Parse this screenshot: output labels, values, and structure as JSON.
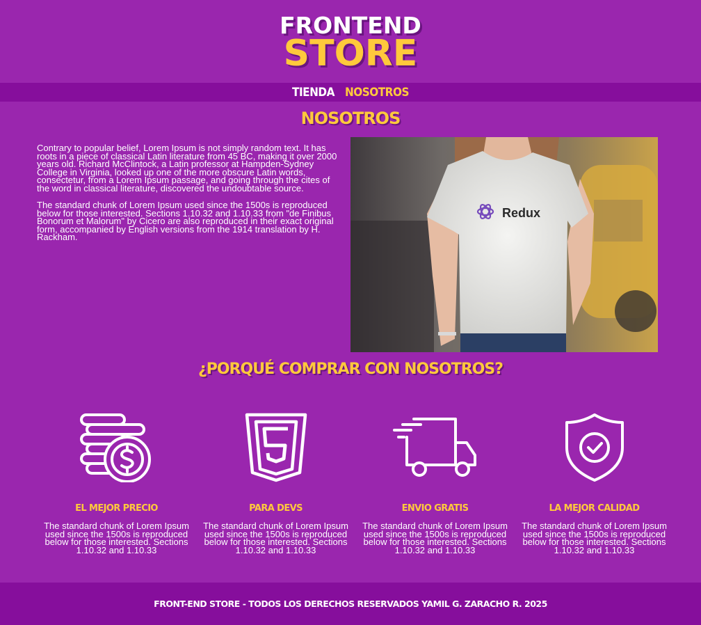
{
  "brand": {
    "line1": "FRONTEND",
    "line2": "STORE"
  },
  "nav": {
    "items": [
      {
        "label": "TIENDA"
      },
      {
        "label": "NOSOTROS"
      }
    ]
  },
  "about": {
    "title": "NOSOTROS",
    "paragraphs": [
      "Contrary to popular belief, Lorem Ipsum is not simply random text. It has roots in a piece of classical Latin literature from 45 BC, making it over 2000 years old. Richard McClintock, a Latin professor at Hampden-Sydney College in Virginia, looked up one of the more obscure Latin words, consectetur, from a Lorem Ipsum passage, and going through the cites of the word in classical literature, discovered the undoubtable source.",
      "The standard chunk of Lorem Ipsum used since the 1500s is reproduced below for those interested. Sections 1.10.32 and 1.10.33 from \"de Finibus Bonorum et Malorum\" by Cicero are also reproduced in their exact original form, accompanied by English versions from the 1914 translation by H. Rackham."
    ],
    "image": {
      "shirt_text": "Redux",
      "icon": "redux-logo-icon"
    }
  },
  "why": {
    "title": "¿PORQUÉ COMPRAR CON NOSOTROS?",
    "features": [
      {
        "icon": "coins-dollar-icon",
        "title": "EL MEJOR PRECIO",
        "text": "The standard chunk of Lorem Ipsum used since the 1500s is reproduced below for those interested. Sections 1.10.32 and 1.10.33"
      },
      {
        "icon": "html5-icon",
        "title": "PARA DEVS",
        "text": "The standard chunk of Lorem Ipsum used since the 1500s is reproduced below for those interested. Sections 1.10.32 and 1.10.33"
      },
      {
        "icon": "delivery-truck-icon",
        "title": "ENVIO GRATIS",
        "text": "The standard chunk of Lorem Ipsum used since the 1500s is reproduced below for those interested. Sections 1.10.32 and 1.10.33"
      },
      {
        "icon": "shield-check-icon",
        "title": "LA MEJOR CALIDAD",
        "text": "The standard chunk of Lorem Ipsum used since the 1500s is reproduced below for those interested. Sections 1.10.32 and 1.10.33"
      }
    ]
  },
  "footer": {
    "text": "FRONT-END STORE - TODOS LOS DERECHOS RESERVADOS YAMIL G. ZARACHO R. 2025"
  },
  "colors": {
    "background": "#9a26ae",
    "nav_bar": "#860e9c",
    "accent": "#ffc93c",
    "text": "#ffffff"
  }
}
